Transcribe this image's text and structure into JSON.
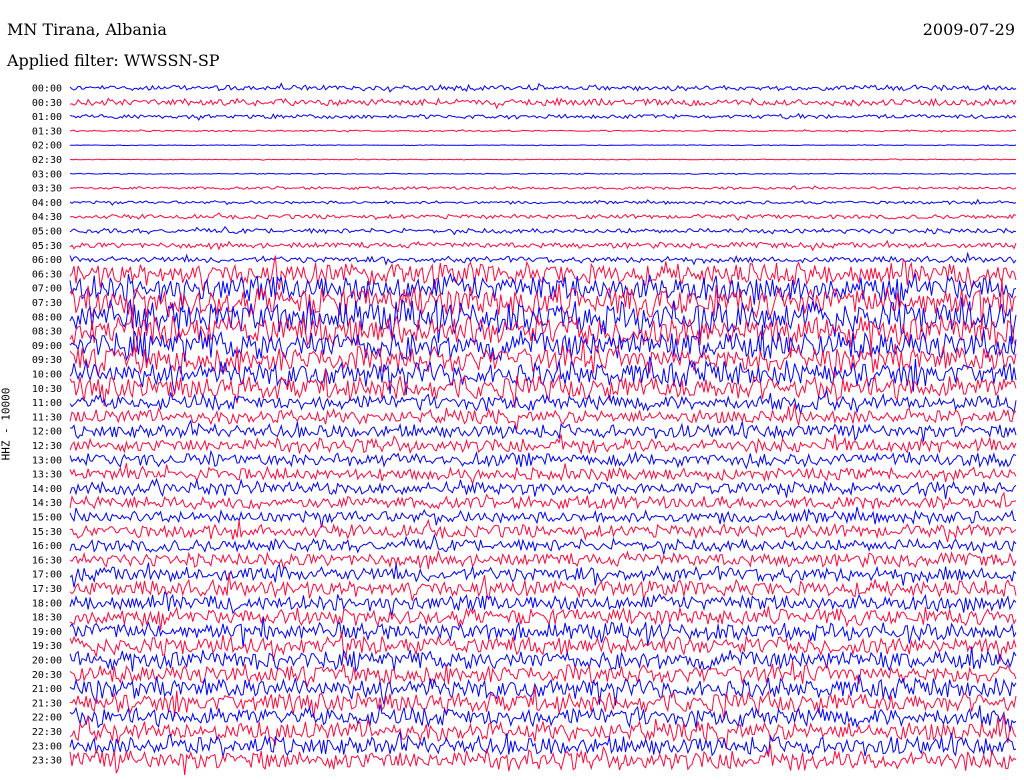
{
  "header": {
    "station": "MN Tirana, Albania",
    "date": "2009-07-29",
    "filter": "Applied filter: WWSSN-SP"
  },
  "chart_data": {
    "type": "line",
    "title": "MN Tirana, Albania",
    "ylabel": "HHZ - 10000",
    "colors": [
      "#0000ff",
      "#ff0a3c"
    ],
    "trace_labels": [
      "00:00",
      "00:30",
      "01:00",
      "01:30",
      "02:00",
      "02:30",
      "03:00",
      "03:30",
      "04:00",
      "04:30",
      "05:00",
      "05:30",
      "06:00",
      "06:30",
      "07:00",
      "07:30",
      "08:00",
      "08:30",
      "09:00",
      "09:30",
      "10:00",
      "10:30",
      "11:00",
      "11:30",
      "12:00",
      "12:30",
      "13:00",
      "13:30",
      "14:00",
      "14:30",
      "15:00",
      "15:30",
      "16:00",
      "16:30",
      "17:00",
      "17:30",
      "18:00",
      "18:30",
      "19:00",
      "19:30",
      "20:00",
      "20:30",
      "21:00",
      "21:30",
      "22:00",
      "22:30",
      "23:00",
      "23:30"
    ],
    "amplitude": [
      0.45,
      0.55,
      0.35,
      0.12,
      0.06,
      0.07,
      0.08,
      0.22,
      0.25,
      0.35,
      0.4,
      0.45,
      0.5,
      1.8,
      2.2,
      2.4,
      2.6,
      2.4,
      2.3,
      2.1,
      2.0,
      1.9,
      1.2,
      1.1,
      1.1,
      1.15,
      1.1,
      1.0,
      1.0,
      1.0,
      1.0,
      1.05,
      1.0,
      1.05,
      1.2,
      1.3,
      1.3,
      1.35,
      1.4,
      1.45,
      1.5,
      1.5,
      1.6,
      1.6,
      1.5,
      1.5,
      1.5,
      1.6
    ],
    "grid": false
  }
}
